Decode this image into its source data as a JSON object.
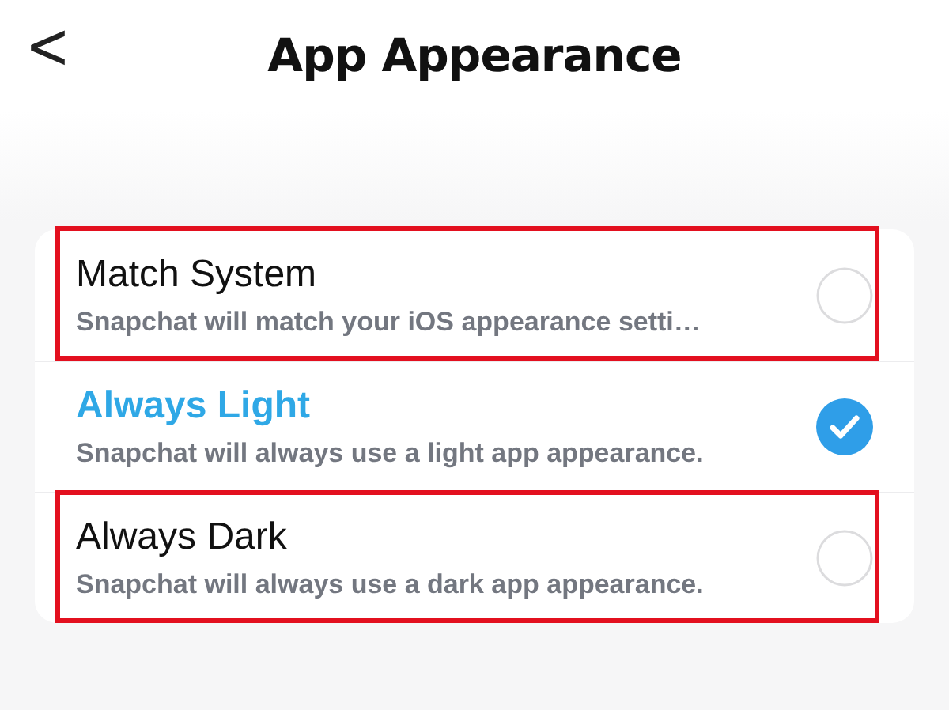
{
  "header": {
    "back": "<",
    "title": "App Appearance"
  },
  "options": [
    {
      "title": "Match System",
      "description": "Snapchat will match your iOS appearance setti…",
      "selected": false,
      "highlighted": true
    },
    {
      "title": "Always Light",
      "description": "Snapchat will always use a light app appearance.",
      "selected": true,
      "highlighted": false
    },
    {
      "title": "Always Dark",
      "description": "Snapchat will always use a dark app appearance.",
      "selected": false,
      "highlighted": true
    }
  ]
}
